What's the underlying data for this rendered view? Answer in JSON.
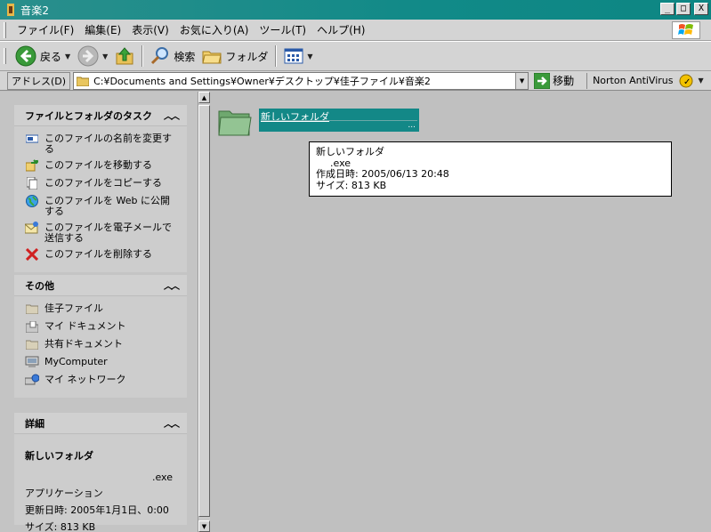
{
  "window": {
    "title": "音楽2",
    "controls": {
      "minimize": "_",
      "maximize": "□",
      "close": "X"
    }
  },
  "menu": {
    "items": [
      "ファイル(F)",
      "編集(E)",
      "表示(V)",
      "お気に入り(A)",
      "ツール(T)",
      "ヘルプ(H)"
    ]
  },
  "toolbar": {
    "back_label": "戻る",
    "search_label": "検索",
    "folders_label": "フォルダ"
  },
  "address": {
    "label": "アドレス(D)",
    "path": "C:¥Documents and Settings¥Owner¥デスクトップ¥佳子ファイル¥音楽2",
    "go_label": "移動",
    "norton_label": "Norton AntiVirus"
  },
  "tasks_panel": {
    "title": "ファイルとフォルダのタスク",
    "items": [
      "このファイルの名前を変更する",
      "このファイルを移動する",
      "このファイルをコピーする",
      "このファイルを Web に公開する",
      "このファイルを電子メールで送信する",
      "このファイルを削除する"
    ]
  },
  "other_panel": {
    "title": "その他",
    "items": [
      "佳子ファイル",
      "マイ ドキュメント",
      "共有ドキュメント",
      "MyComputer",
      "マイ ネットワーク"
    ]
  },
  "details_panel": {
    "title": "詳細",
    "name": "新しいフォルダ",
    "ext": ".exe",
    "type": "アプリケーション",
    "modified": "更新日時: 2005年1月1日、0:00",
    "size": "サイズ: 813 KB"
  },
  "content": {
    "item_name": "新しいフォルダ",
    "item_sub": "...",
    "tooltip": {
      "name": "新しいフォルダ",
      "ext": ".exe",
      "created": "作成日時: 2005/06/13 20:48",
      "size": "サイズ: 813 KB"
    }
  },
  "colors": {
    "titlebar": "#138887",
    "selection": "#138887",
    "folder": "#8dc08d"
  }
}
